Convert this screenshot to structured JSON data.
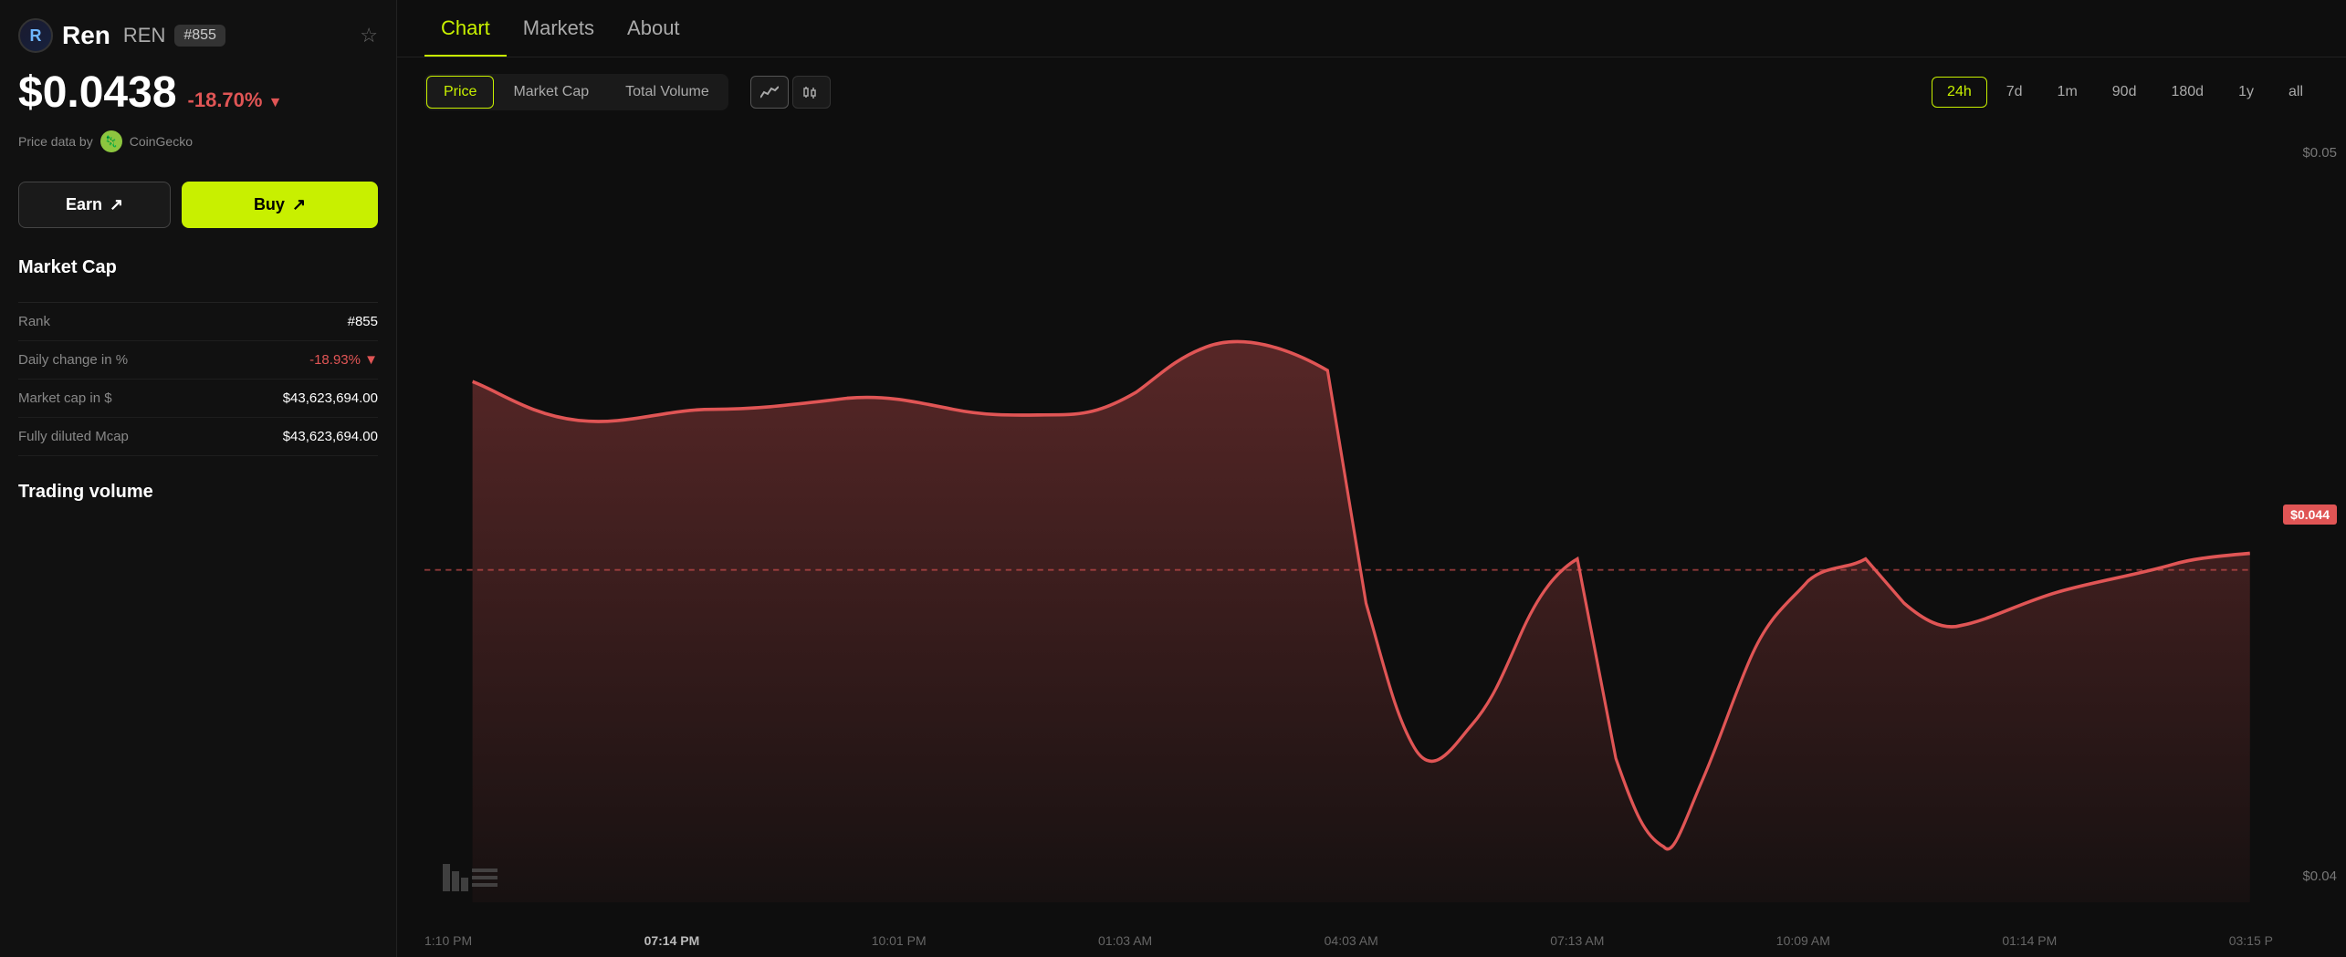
{
  "coin": {
    "name": "Ren",
    "ticker": "REN",
    "rank": "#855",
    "logo_letter": "R",
    "price": "$0.0438",
    "change_pct": "-18.70%",
    "change_arrow": "▼",
    "price_source": "Price data by",
    "price_source_name": "CoinGecko"
  },
  "buttons": {
    "earn": "Earn",
    "earn_icon": "↗",
    "buy": "Buy",
    "buy_icon": "↗",
    "star_icon": "☆"
  },
  "market_cap_section": {
    "title": "Market Cap",
    "rank_label": "Rank",
    "rank_value": "#855",
    "daily_change_label": "Daily change in %",
    "daily_change_value": "-18.93%",
    "daily_change_arrow": "▼",
    "market_cap_label": "Market cap in $",
    "market_cap_value": "$43,623,694.00",
    "fully_diluted_label": "Fully diluted Mcap",
    "fully_diluted_value": "$43,623,694.00"
  },
  "trading_volume_section": {
    "title": "Trading volume"
  },
  "chart_tabs": [
    {
      "label": "Chart",
      "active": true
    },
    {
      "label": "Markets",
      "active": false
    },
    {
      "label": "About",
      "active": false
    }
  ],
  "chart_filters": [
    {
      "label": "Price",
      "active": true
    },
    {
      "label": "Market Cap",
      "active": false
    },
    {
      "label": "Total Volume",
      "active": false
    }
  ],
  "chart_types": [
    {
      "label": "line",
      "icon": "📈",
      "active": true
    },
    {
      "label": "candle",
      "icon": "⊞",
      "active": false
    }
  ],
  "time_filters": [
    {
      "label": "24h",
      "active": true
    },
    {
      "label": "7d",
      "active": false
    },
    {
      "label": "1m",
      "active": false
    },
    {
      "label": "90d",
      "active": false
    },
    {
      "label": "180d",
      "active": false
    },
    {
      "label": "1y",
      "active": false
    },
    {
      "label": "all",
      "active": false
    }
  ],
  "x_axis_labels": [
    {
      "label": "1:10 PM",
      "bold": false
    },
    {
      "label": "07:14 PM",
      "bold": true
    },
    {
      "label": "10:01 PM",
      "bold": false
    },
    {
      "label": "01:03 AM",
      "bold": false
    },
    {
      "label": "04:03 AM",
      "bold": false
    },
    {
      "label": "07:13 AM",
      "bold": false
    },
    {
      "label": "10:09 AM",
      "bold": false
    },
    {
      "label": "01:14 PM",
      "bold": false
    },
    {
      "label": "03:15 P",
      "bold": false
    }
  ],
  "y_axis_labels": [
    "$0.05",
    "",
    "$0.044",
    "",
    "$0.04"
  ],
  "current_price_label": "$0.044",
  "colors": {
    "accent": "#c8f000",
    "negative": "#e05555",
    "background": "#0e0e0e",
    "panel": "#111111"
  }
}
